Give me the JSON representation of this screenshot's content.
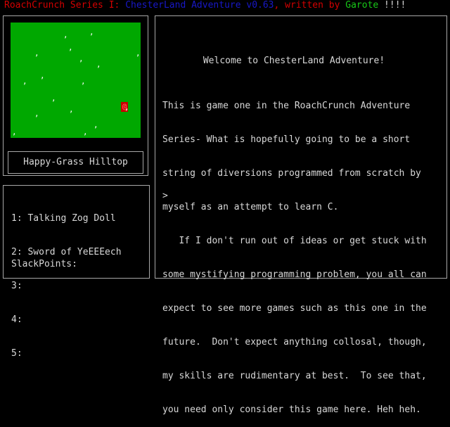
{
  "header": {
    "part1": "RoachCrunch Series I: ",
    "part2": "ChesterLand Adventure v0.63",
    "part3": ", written by ",
    "part4": "Garote",
    "part5": " !!!!",
    "colors": {
      "part1": "#d40000",
      "part2": "#1818c8",
      "part3": "#d40000",
      "part4": "#18c818",
      "part5": "#d8d8d8"
    }
  },
  "map": {
    "grass_color": "#00a800",
    "tuft_glyph": ",",
    "player_glyph": "@",
    "player_bg": "#c80000",
    "player_fg": "#ff5050",
    "location_name": "Happy-Grass Hilltop"
  },
  "inventory": {
    "items": [
      "1: Talking Zog Doll",
      "2: Sword of YeEEEech",
      "3:",
      "4:",
      "5:"
    ],
    "slackpoints_label": "SlackPoints:"
  },
  "message": {
    "heading": "Welcome to ChesterLand Adventure!",
    "lines": [
      "This is game one in the RoachCrunch Adventure",
      "Series- What is hopefully going to be a short",
      "string of diversions programmed from scratch by",
      "myself as an attempt to learn C.",
      "   If I don't run out of ideas or get stuck with",
      "some mystifying programming problem, you all can",
      "expect to see more games such as this one in the",
      "future.  Don't expect anything collosal, though,",
      "my skills are rudimentary at best.  To see that,",
      "you need only consider this game here. Heh heh."
    ],
    "prompt": ">"
  },
  "colors": {
    "background": "#000000",
    "text": "#d8d8d8",
    "border": "#a8a8a8"
  }
}
